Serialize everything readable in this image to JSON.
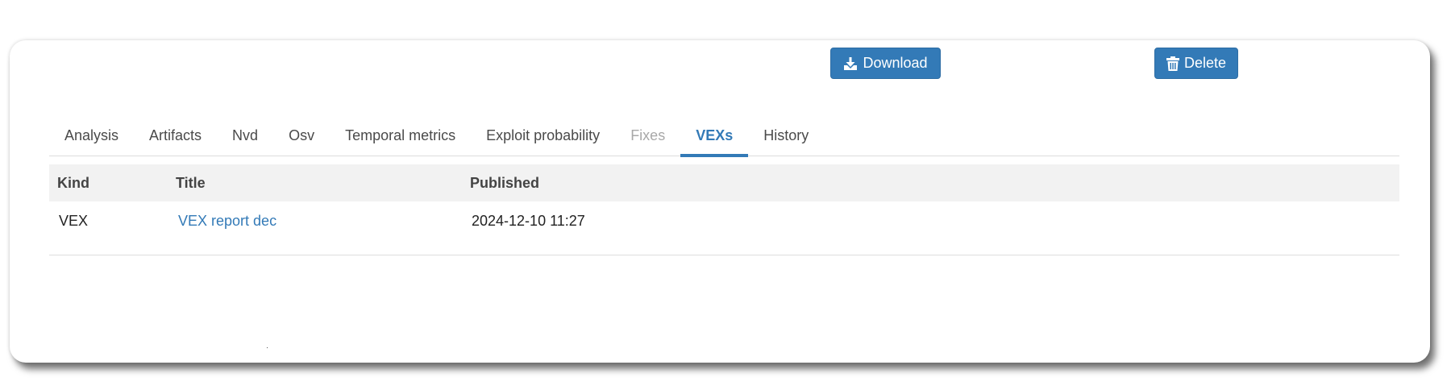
{
  "tabs": [
    {
      "label": "Analysis",
      "state": "normal"
    },
    {
      "label": "Artifacts",
      "state": "normal"
    },
    {
      "label": "Nvd",
      "state": "normal"
    },
    {
      "label": "Osv",
      "state": "normal"
    },
    {
      "label": "Temporal metrics",
      "state": "normal"
    },
    {
      "label": "Exploit probability",
      "state": "normal"
    },
    {
      "label": "Fixes",
      "state": "disabled"
    },
    {
      "label": "VEXs",
      "state": "active"
    },
    {
      "label": "History",
      "state": "normal"
    }
  ],
  "table": {
    "headers": {
      "kind": "Kind",
      "title": "Title",
      "published": "Published"
    },
    "rows": [
      {
        "kind": "VEX",
        "title": "VEX report dec",
        "published": "2024-12-10 11:27",
        "download_label": "Download",
        "delete_label": "Delete"
      }
    ]
  },
  "icons": {
    "download": "download-icon",
    "delete": "trash-icon"
  },
  "colors": {
    "accent": "#337ab7",
    "header_bg": "#f2f2f2",
    "disabled_tab": "#a8a8a8"
  }
}
